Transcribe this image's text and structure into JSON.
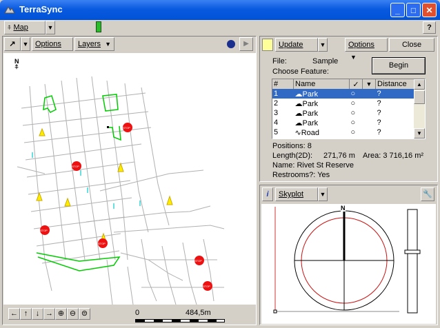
{
  "window": {
    "title": "TerraSync",
    "minimize": "_",
    "maximize": "□",
    "close": "✕"
  },
  "menubar": {
    "section": "Map",
    "help": "?"
  },
  "map_panel": {
    "options": "Options",
    "layers": "Layers",
    "north": "N",
    "scale_start": "0",
    "scale_end": "484,5m",
    "nav": [
      "←",
      "↑",
      "↓",
      "→",
      "⊕",
      "⊖",
      "⊜"
    ],
    "sign_text": "STOP"
  },
  "feature_panel": {
    "update": "Update",
    "options": "Options",
    "close": "Close",
    "file_label": "File:",
    "file_value": "Sample",
    "choose_feature": "Choose Feature:",
    "begin": "Begin",
    "columns": [
      "#",
      "Name",
      "✓",
      "▼",
      "Distance"
    ],
    "rows": [
      {
        "num": "1",
        "name": "Park",
        "dist": "?"
      },
      {
        "num": "2",
        "name": "Park",
        "dist": "?"
      },
      {
        "num": "3",
        "name": "Park",
        "dist": "?"
      },
      {
        "num": "4",
        "name": "Park",
        "dist": "?"
      },
      {
        "num": "5",
        "name": "Road",
        "dist": "?"
      }
    ],
    "positions": "Positions:  8",
    "length_label": "Length(2D):",
    "length_value": "271,76 m",
    "area": "Area: 3 716,16 m²",
    "name_line": "Name: Rivet St Reserve",
    "restrooms": "Restrooms?: Yes"
  },
  "sky_panel": {
    "info_icon": "i",
    "view": "Skyplot",
    "north": "N"
  },
  "colors": {
    "title_blue": "#0a5ae0",
    "selection": "#316ac5",
    "park_green": "#00cc00",
    "stop_red": "#ee1111",
    "marker_yellow": "#ffee00"
  }
}
